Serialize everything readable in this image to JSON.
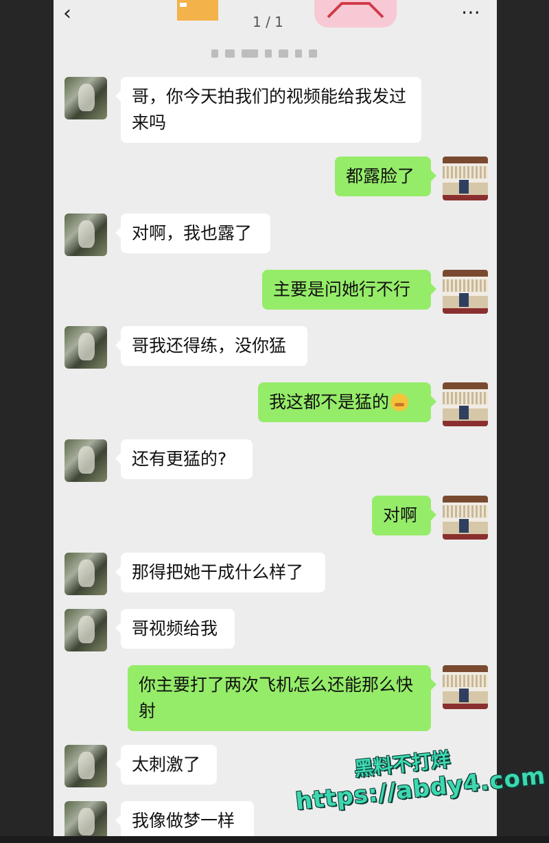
{
  "header": {
    "back_icon": "chevron-left-icon",
    "more_icon": "ellipsis-icon",
    "page_indicator": "1 / 1"
  },
  "messages": [
    {
      "side": "in",
      "text": "哥，你今天拍我们的视频能给我发过来吗"
    },
    {
      "side": "out",
      "text": "都露脸了"
    },
    {
      "side": "in",
      "text": "对啊，我也露了"
    },
    {
      "side": "out",
      "text": "主要是问她行不行"
    },
    {
      "side": "in",
      "text": "哥我还得练，没你猛"
    },
    {
      "side": "out",
      "text": "我这都不是猛的",
      "emoji": "embarrassed-emoji"
    },
    {
      "side": "in",
      "text": "还有更猛的?"
    },
    {
      "side": "out",
      "text": "对啊"
    },
    {
      "side": "in",
      "text": "那得把她干成什么样了"
    },
    {
      "side": "in",
      "text": "哥视频给我"
    },
    {
      "side": "out",
      "text": "你主要打了两次飞机怎么还能那么快射"
    },
    {
      "side": "in",
      "text": "太刺激了"
    },
    {
      "side": "in",
      "text": "我像做梦一样"
    }
  ],
  "watermark": {
    "line1": "黑料不打烊",
    "line2": "https://abdy4.com"
  },
  "colors": {
    "incoming_bubble": "#ffffff",
    "outgoing_bubble": "#95ec69",
    "chat_background": "#ededed"
  }
}
